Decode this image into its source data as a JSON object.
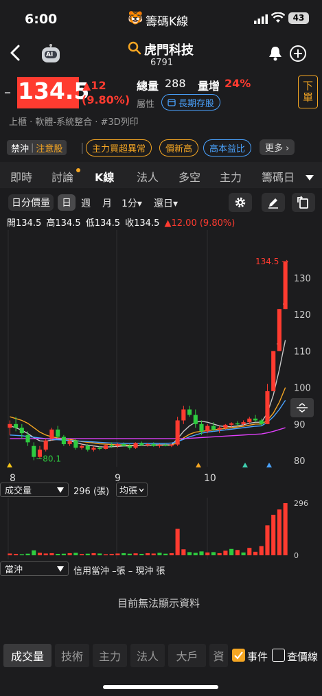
{
  "status": {
    "time": "6:00",
    "app_title": "籌碼K線",
    "battery": "43"
  },
  "header": {
    "stock_name": "虎門科技",
    "stock_code": "6791",
    "ai_label": "AI"
  },
  "quote": {
    "dash": "–",
    "price": "134.5",
    "change": "▲12",
    "change_pct": "(9.80%)",
    "volume_label": "總量",
    "volume": "288",
    "vol_inc_label": "量增",
    "vol_inc_pct": "24%",
    "attr_label": "屬性",
    "attr_tag": "長期存股",
    "order_btn": "下單",
    "category": "上櫃 · 軟體-系統整合 · #3D列印"
  },
  "tags": {
    "warn_a": "禁沖",
    "warn_b": "注意股",
    "items": [
      "主力買超異常",
      "價新高",
      "高本益比"
    ],
    "more": "更多 ›"
  },
  "tabs": [
    "即時",
    "討論",
    "K線",
    "法人",
    "多空",
    "主力",
    "籌碼日"
  ],
  "toolbar": {
    "minute_vol": "日分價量",
    "day": "日",
    "week": "週",
    "month": "月",
    "minute": "1分▾",
    "restore": "還日▾"
  },
  "ohlc": {
    "open_l": "開",
    "open": "134.5",
    "high_l": "高",
    "high": "134.5",
    "low_l": "低",
    "low": "134.5",
    "close_l": "收",
    "close": "134.5",
    "chg": "▲12.00 (9.80%)"
  },
  "chart_data": {
    "type": "candlestick",
    "price_axis": [
      "130",
      "120",
      "110",
      "100",
      "90",
      "80"
    ],
    "ylim": [
      80,
      134.5
    ],
    "x_labels": [
      "8",
      "9",
      "10"
    ],
    "last_price_label": "134.5",
    "low_marker": "80.1",
    "candles": [
      {
        "o": 89.0,
        "h": 91.0,
        "l": 87.0,
        "c": 90.0
      },
      {
        "o": 90.0,
        "h": 92.0,
        "l": 88.0,
        "c": 89.0
      },
      {
        "o": 89.0,
        "h": 90.0,
        "l": 86.0,
        "c": 87.5
      },
      {
        "o": 87.0,
        "h": 88.0,
        "l": 84.0,
        "c": 85.0
      },
      {
        "o": 84.0,
        "h": 85.0,
        "l": 80.1,
        "c": 81.0
      },
      {
        "o": 81.0,
        "h": 84.0,
        "l": 80.5,
        "c": 83.0
      },
      {
        "o": 83.0,
        "h": 86.0,
        "l": 82.5,
        "c": 85.5
      },
      {
        "o": 86.0,
        "h": 89.0,
        "l": 85.5,
        "c": 88.5
      },
      {
        "o": 88.5,
        "h": 89.5,
        "l": 86.0,
        "c": 86.5
      },
      {
        "o": 86.5,
        "h": 87.0,
        "l": 84.0,
        "c": 84.5
      },
      {
        "o": 84.5,
        "h": 86.0,
        "l": 84.0,
        "c": 85.5
      },
      {
        "o": 85.5,
        "h": 86.0,
        "l": 83.0,
        "c": 83.5
      },
      {
        "o": 83.5,
        "h": 84.5,
        "l": 83.0,
        "c": 84.0
      },
      {
        "o": 84.0,
        "h": 84.5,
        "l": 82.5,
        "c": 83.0
      },
      {
        "o": 83.0,
        "h": 84.0,
        "l": 82.5,
        "c": 83.5
      },
      {
        "o": 83.5,
        "h": 84.0,
        "l": 82.8,
        "c": 83.2
      },
      {
        "o": 83.2,
        "h": 84.5,
        "l": 83.0,
        "c": 84.2
      },
      {
        "o": 84.2,
        "h": 85.0,
        "l": 83.5,
        "c": 84.0
      },
      {
        "o": 84.0,
        "h": 84.8,
        "l": 83.5,
        "c": 84.5
      },
      {
        "o": 84.5,
        "h": 85.0,
        "l": 83.8,
        "c": 84.0
      },
      {
        "o": 84.0,
        "h": 84.5,
        "l": 83.0,
        "c": 83.5
      },
      {
        "o": 83.5,
        "h": 85.0,
        "l": 83.2,
        "c": 84.8
      },
      {
        "o": 84.8,
        "h": 85.2,
        "l": 84.0,
        "c": 84.2
      },
      {
        "o": 84.2,
        "h": 84.8,
        "l": 83.8,
        "c": 84.5
      },
      {
        "o": 84.5,
        "h": 85.0,
        "l": 83.8,
        "c": 84.0
      },
      {
        "o": 84.0,
        "h": 84.6,
        "l": 83.5,
        "c": 84.3
      },
      {
        "o": 84.3,
        "h": 84.8,
        "l": 83.9,
        "c": 84.1
      },
      {
        "o": 84.1,
        "h": 84.5,
        "l": 83.7,
        "c": 84.4
      },
      {
        "o": 84.4,
        "h": 92.0,
        "l": 84.0,
        "c": 91.0
      },
      {
        "o": 91.0,
        "h": 95.0,
        "l": 90.0,
        "c": 94.0
      },
      {
        "o": 94.0,
        "h": 95.0,
        "l": 92.0,
        "c": 92.5
      },
      {
        "o": 92.5,
        "h": 94.0,
        "l": 89.0,
        "c": 90.0
      },
      {
        "o": 90.0,
        "h": 91.0,
        "l": 87.0,
        "c": 88.0
      },
      {
        "o": 88.0,
        "h": 90.0,
        "l": 87.5,
        "c": 89.5
      },
      {
        "o": 89.5,
        "h": 90.5,
        "l": 88.0,
        "c": 88.5
      },
      {
        "o": 88.5,
        "h": 89.5,
        "l": 87.5,
        "c": 89.0
      },
      {
        "o": 89.0,
        "h": 90.0,
        "l": 88.5,
        "c": 89.8
      },
      {
        "o": 89.8,
        "h": 90.5,
        "l": 89.0,
        "c": 90.2
      },
      {
        "o": 90.2,
        "h": 90.8,
        "l": 89.5,
        "c": 90.0
      },
      {
        "o": 90.0,
        "h": 91.0,
        "l": 89.5,
        "c": 90.5
      },
      {
        "o": 90.5,
        "h": 92.0,
        "l": 90.0,
        "c": 91.5
      },
      {
        "o": 91.5,
        "h": 92.5,
        "l": 90.5,
        "c": 91.0
      },
      {
        "o": 91.0,
        "h": 91.5,
        "l": 89.5,
        "c": 90.0
      },
      {
        "o": 90.0,
        "h": 101.0,
        "l": 90.0,
        "c": 99.0
      },
      {
        "o": 99.0,
        "h": 110.0,
        "l": 99.0,
        "c": 110.0
      },
      {
        "o": 110.0,
        "h": 121.5,
        "l": 110.0,
        "c": 121.5
      },
      {
        "o": 121.5,
        "h": 134.5,
        "l": 121.5,
        "c": 134.5
      }
    ],
    "ma_series": [
      {
        "color": "#f5a623",
        "values": [
          92.0,
          91.5,
          91.0,
          90.2,
          89.0,
          87.8,
          87.0,
          86.5,
          86.2,
          86.0,
          85.8,
          85.5,
          85.2,
          85.0,
          84.8,
          84.6,
          84.5,
          84.4,
          84.3,
          84.3,
          84.2,
          84.2,
          84.2,
          84.2,
          84.2,
          84.2,
          84.2,
          84.2,
          85.0,
          86.2,
          87.2,
          87.8,
          88.0,
          88.2,
          88.4,
          88.6,
          88.8,
          89.0,
          89.2,
          89.4,
          89.7,
          90.0,
          90.0,
          91.0,
          93.0,
          96.0,
          100.0
        ]
      },
      {
        "color": "#c8c8c8",
        "values": [
          89.5,
          89.0,
          88.3,
          87.4,
          86.3,
          85.4,
          85.3,
          85.6,
          85.8,
          85.7,
          85.4,
          85.0,
          84.5,
          84.2,
          84.0,
          83.8,
          83.7,
          83.8,
          83.9,
          84.0,
          84.0,
          84.1,
          84.2,
          84.2,
          84.3,
          84.3,
          84.3,
          84.3,
          86.0,
          88.0,
          89.5,
          90.5,
          90.8,
          90.5,
          90.0,
          89.5,
          89.3,
          89.3,
          89.5,
          89.8,
          90.2,
          90.5,
          90.5,
          93.0,
          98.0,
          105.0,
          113.0
        ]
      },
      {
        "color": "#4aa3ff",
        "values": [
          87.0,
          86.9,
          86.8,
          86.6,
          86.4,
          86.2,
          86.0,
          85.8,
          85.7,
          85.6,
          85.5,
          85.4,
          85.3,
          85.2,
          85.1,
          85.0,
          84.9,
          84.8,
          84.8,
          84.7,
          84.7,
          84.7,
          84.7,
          84.7,
          84.7,
          84.7,
          84.7,
          84.8,
          85.2,
          85.8,
          86.5,
          87.0,
          87.5,
          87.8,
          88.0,
          88.2,
          88.4,
          88.6,
          88.8,
          89.0,
          89.2,
          89.4,
          89.5,
          90.5,
          92.0,
          94.0,
          96.5
        ]
      },
      {
        "color": "#e040fb",
        "values": [
          86.0,
          86.0,
          86.0,
          86.0,
          86.0,
          86.0,
          86.0,
          86.0,
          86.0,
          86.0,
          86.0,
          86.0,
          86.0,
          86.0,
          86.0,
          86.0,
          86.0,
          86.0,
          86.0,
          86.0,
          86.0,
          86.0,
          86.0,
          86.0,
          86.0,
          86.0,
          86.0,
          86.0,
          86.0,
          86.0,
          86.1,
          86.2,
          86.3,
          86.4,
          86.5,
          86.6,
          86.7,
          86.8,
          86.9,
          87.0,
          87.1,
          87.2,
          87.3,
          87.6,
          88.0,
          88.5,
          89.0
        ]
      }
    ],
    "volume_max_label": "296",
    "volume_min_label": "0",
    "volume": [
      {
        "v": 10,
        "up": true
      },
      {
        "v": 8,
        "up": true
      },
      {
        "v": 6,
        "up": false
      },
      {
        "v": 9,
        "up": false
      },
      {
        "v": 28,
        "up": false
      },
      {
        "v": 14,
        "up": true
      },
      {
        "v": 10,
        "up": true
      },
      {
        "v": 12,
        "up": true
      },
      {
        "v": 8,
        "up": false
      },
      {
        "v": 9,
        "up": false
      },
      {
        "v": 12,
        "up": true
      },
      {
        "v": 14,
        "up": false
      },
      {
        "v": 7,
        "up": true
      },
      {
        "v": 9,
        "up": false
      },
      {
        "v": 12,
        "up": true
      },
      {
        "v": 10,
        "up": false
      },
      {
        "v": 6,
        "up": true
      },
      {
        "v": 8,
        "up": true
      },
      {
        "v": 10,
        "up": true
      },
      {
        "v": 12,
        "up": false
      },
      {
        "v": 9,
        "up": false
      },
      {
        "v": 11,
        "up": true
      },
      {
        "v": 8,
        "up": false
      },
      {
        "v": 12,
        "up": true
      },
      {
        "v": 10,
        "up": true
      },
      {
        "v": 14,
        "up": false
      },
      {
        "v": 9,
        "up": false
      },
      {
        "v": 12,
        "up": true
      },
      {
        "v": 150,
        "up": true
      },
      {
        "v": 34,
        "up": true
      },
      {
        "v": 18,
        "up": false
      },
      {
        "v": 14,
        "up": false
      },
      {
        "v": 22,
        "up": false
      },
      {
        "v": 16,
        "up": true
      },
      {
        "v": 18,
        "up": false
      },
      {
        "v": 12,
        "up": true
      },
      {
        "v": 26,
        "up": true
      },
      {
        "v": 36,
        "up": false
      },
      {
        "v": 30,
        "up": true
      },
      {
        "v": 16,
        "up": false
      },
      {
        "v": 42,
        "up": true
      },
      {
        "v": 20,
        "up": true
      },
      {
        "v": 52,
        "up": true
      },
      {
        "v": 170,
        "up": true
      },
      {
        "v": 230,
        "up": true
      },
      {
        "v": 260,
        "up": true
      },
      {
        "v": 296,
        "up": true
      }
    ]
  },
  "volume_panel": {
    "selector": "成交量",
    "value": "296 (張)",
    "avg": "均張"
  },
  "daytrade_panel": {
    "selector": "當沖",
    "info": "信用當沖 –張 – 現沖 張",
    "empty": "目前無法顯示資料"
  },
  "bottom_tabs": [
    "成交量",
    "技術",
    "主力",
    "法人",
    "大戶",
    "資"
  ],
  "bottom_checks": {
    "event": "事件",
    "price_query": "查價線"
  },
  "colors": {
    "up": "#ff3b30",
    "down": "#2ecc40",
    "accent": "#4aa3ff",
    "orange": "#f5a623"
  }
}
